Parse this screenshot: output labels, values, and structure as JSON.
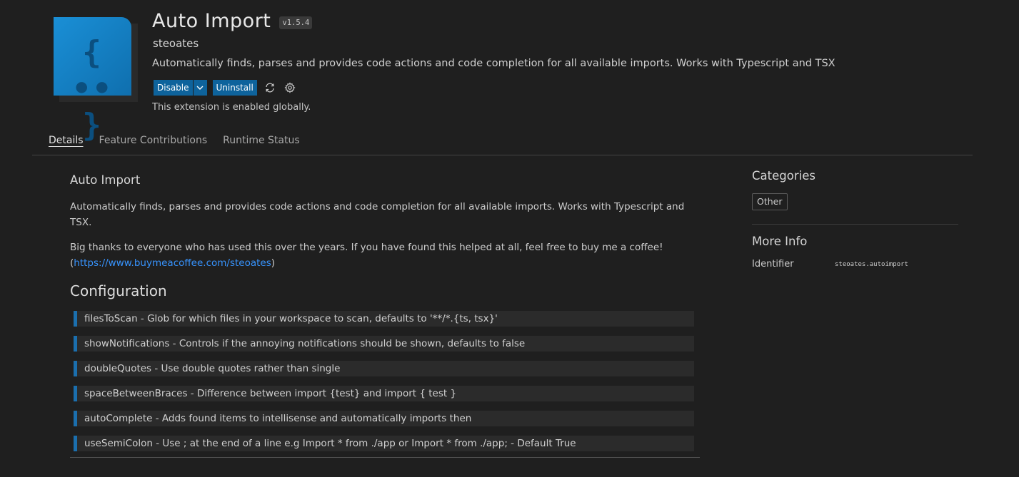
{
  "extension": {
    "icon_text": "{ •• }",
    "name": "Auto Import",
    "version": "v1.5.4",
    "publisher": "steoates",
    "description": "Automatically finds, parses and provides code actions and code completion for all available imports. Works with Typescript and TSX",
    "status": "This extension is enabled globally."
  },
  "actions": {
    "disable_label": "Disable",
    "uninstall_label": "Uninstall",
    "icons": [
      "chevron-down-icon",
      "sync-icon",
      "gear-icon"
    ]
  },
  "tabs": [
    {
      "label": "Details",
      "active": true
    },
    {
      "label": "Feature Contributions",
      "active": false
    },
    {
      "label": "Runtime Status",
      "active": false
    }
  ],
  "readme": {
    "heading": "Auto Import",
    "paragraph1": "Automatically finds, parses and provides code actions and code completion for all available imports. Works with Typescript and TSX.",
    "paragraph2_text": "Big thanks to everyone who has used this over the years. If you have found this helped at all, feel free to buy me a coffee!",
    "paragraph2_open": "(",
    "paragraph2_link": "https://www.buymeacoffee.com/steoates",
    "paragraph2_close": ")",
    "config_heading": "Configuration",
    "config_items": [
      "filesToScan - Glob for which files in your workspace to scan, defaults to '**/*.{ts, tsx}'",
      "showNotifications - Controls if the annoying notifications should be shown, defaults to false",
      "doubleQuotes - Use double quotes rather than single",
      "spaceBetweenBraces - Difference between import {test} and import { test }",
      "autoComplete - Adds found items to intellisense and automatically imports then",
      "useSemiColon - Use ; at the end of a line e.g Import * from ./app or Import * from ./app; - Default True"
    ]
  },
  "sidebar": {
    "categories_heading": "Categories",
    "category": "Other",
    "more_info_heading": "More Info",
    "identifier_label": "Identifier",
    "identifier_value": "steoates.autoimport"
  },
  "colors": {
    "background": "#1f1f1f",
    "button": "#0e639c",
    "link": "#3794ff",
    "icon": "#1381c4",
    "quote_border": "#1b6fae"
  }
}
